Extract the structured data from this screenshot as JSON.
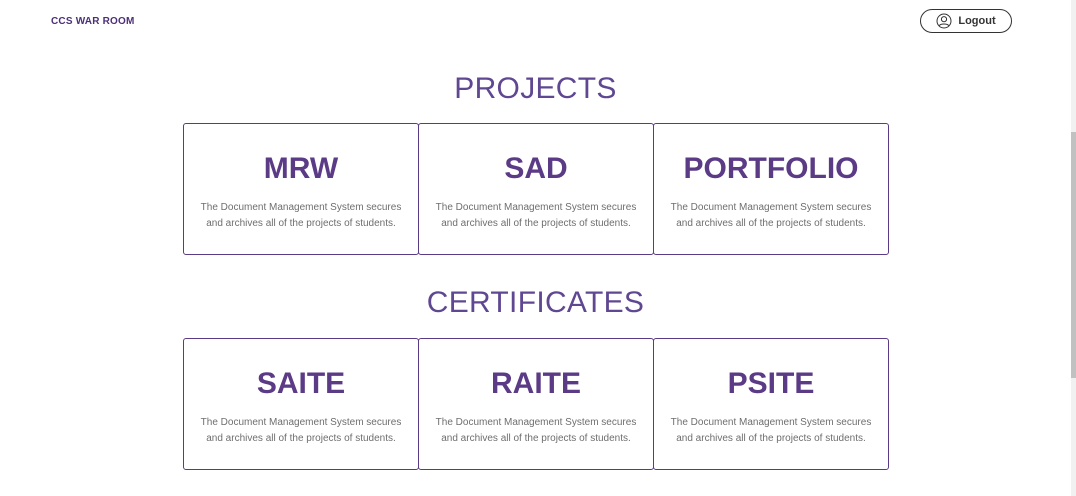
{
  "header": {
    "brand": "CCS WAR ROOM",
    "logout_label": "Logout",
    "logout_icon": "user-circle-icon"
  },
  "sections": [
    {
      "title": "PROJECTS",
      "cards": [
        {
          "title": "MRW",
          "description": "The Document Management System secures and archives all of the projects of students."
        },
        {
          "title": "SAD",
          "description": "The Document Management System secures and archives all of the projects of students."
        },
        {
          "title": "PORTFOLIO",
          "description": "The Document Management System secures and archives all of the projects of students."
        }
      ]
    },
    {
      "title": "CERTIFICATES",
      "cards": [
        {
          "title": "SAITE",
          "description": "The Document Management System secures and archives all of the projects of students."
        },
        {
          "title": "RAITE",
          "description": "The Document Management System secures and archives all of the projects of students."
        },
        {
          "title": "PSITE",
          "description": "The Document Management System secures and archives all of the projects of students."
        }
      ]
    }
  ],
  "colors": {
    "accent": "#5b3a86",
    "title": "#5f4791",
    "text_muted": "#6e6e6e"
  }
}
